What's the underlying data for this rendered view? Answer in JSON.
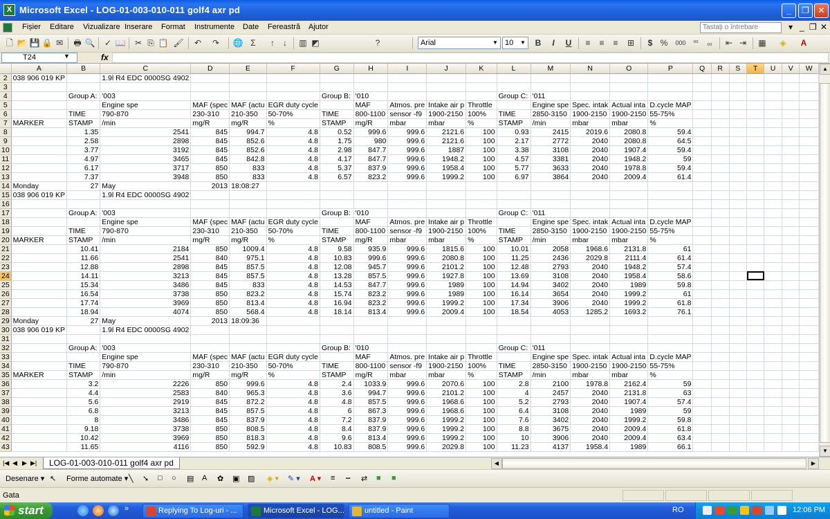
{
  "window": {
    "title": "Microsoft Excel - LOG-01-003-010-011 golf4 axr pd",
    "app_icon": "X"
  },
  "menu": {
    "items": [
      "Fișier",
      "Editare",
      "Vizualizare",
      "Inserare",
      "Format",
      "Instrumente",
      "Date",
      "Fereastră",
      "Ajutor"
    ],
    "help_placeholder": "Tastați o întrebare"
  },
  "toolbar": {
    "font_name": "Arial",
    "font_size": "10",
    "bold": "B",
    "italic": "I",
    "underline": "U",
    "currency": "$",
    "percent": "%",
    "thousands": "000",
    "inc_decimal": "⁰⁰",
    "dec_decimal": "₀₀"
  },
  "formula_bar": {
    "name_box": "T24",
    "fx_label": "fx",
    "formula": ""
  },
  "sheet": {
    "columns": [
      "A",
      "B",
      "C",
      "D",
      "E",
      "F",
      "G",
      "H",
      "I",
      "J",
      "K",
      "L",
      "M",
      "N",
      "O",
      "P",
      "Q",
      "R",
      "S",
      "T",
      "U",
      "V",
      "W"
    ],
    "selected_column": "T",
    "selected_row": "24",
    "rows": [
      {
        "n": "2",
        "c": {
          "A": "038 906 019 KP",
          "C": "1.9l R4 EDC 0000SG  4902"
        }
      },
      {
        "n": "3",
        "c": {}
      },
      {
        "n": "4",
        "c": {
          "B": "Group A:",
          "C": "'003",
          "G": "Group B:",
          "H": "'010",
          "L": "Group C:",
          "M": "'011"
        }
      },
      {
        "n": "5",
        "c": {
          "C": "Engine spe",
          "D": "MAF (spec",
          "E": "MAF (actu",
          "F": "EGR duty cycle",
          "H": "MAF",
          "I": "Atmos. pre",
          "J": "Intake air p",
          "K": "Throttle",
          "M": "Engine spe",
          "N": "Spec. intak",
          "O": "Actual inta",
          "P": "D.cycle MAP"
        }
      },
      {
        "n": "6",
        "c": {
          "B": "TIME",
          "C": "790-870",
          "D": "230-310",
          "E": "210-350",
          "F": "50-70%",
          "G": "TIME",
          "H": "800-1100",
          "I": "sensor -f9",
          "J": "1900-2150",
          "K": "100%",
          "L": "TIME",
          "M": "2850-3150",
          "N": "1900-2150",
          "O": "1900-2150",
          "P": "55-75%"
        }
      },
      {
        "n": "7",
        "c": {
          "A": "MARKER",
          "B": "STAMP",
          "C": "/min",
          "D": "mg/R",
          "E": "mg/R",
          "F": "%",
          "G": "STAMP",
          "H": "mg/R",
          "I": "mbar",
          "J": "mbar",
          "K": "%",
          "L": "STAMP",
          "M": "/min",
          "N": "mbar",
          "O": "mbar",
          "P": "%"
        }
      },
      {
        "n": "8",
        "c": {
          "B": "1.35",
          "C": "2541",
          "D": "845",
          "E": "994.7",
          "F": "4.8",
          "G": "0.52",
          "H": "999.6",
          "I": "999.6",
          "J": "2121.6",
          "K": "100",
          "L": "0.93",
          "M": "2415",
          "N": "2019.6",
          "O": "2080.8",
          "P": "59.4"
        }
      },
      {
        "n": "9",
        "c": {
          "B": "2.58",
          "C": "2898",
          "D": "845",
          "E": "852.6",
          "F": "4.8",
          "G": "1.75",
          "H": "980",
          "I": "999.6",
          "J": "2121.6",
          "K": "100",
          "L": "2.17",
          "M": "2772",
          "N": "2040",
          "O": "2080.8",
          "P": "64.5"
        }
      },
      {
        "n": "10",
        "c": {
          "B": "3.77",
          "C": "3192",
          "D": "845",
          "E": "852.6",
          "F": "4.8",
          "G": "2.98",
          "H": "847.7",
          "I": "999.6",
          "J": "1887",
          "K": "100",
          "L": "3.38",
          "M": "3108",
          "N": "2040",
          "O": "1907.4",
          "P": "59.4"
        }
      },
      {
        "n": "11",
        "c": {
          "B": "4.97",
          "C": "3465",
          "D": "845",
          "E": "842.8",
          "F": "4.8",
          "G": "4.17",
          "H": "847.7",
          "I": "999.6",
          "J": "1948.2",
          "K": "100",
          "L": "4.57",
          "M": "3381",
          "N": "2040",
          "O": "1948.2",
          "P": "59"
        }
      },
      {
        "n": "12",
        "c": {
          "B": "6.17",
          "C": "3717",
          "D": "850",
          "E": "833",
          "F": "4.8",
          "G": "5.37",
          "H": "837.9",
          "I": "999.6",
          "J": "1958.4",
          "K": "100",
          "L": "5.77",
          "M": "3633",
          "N": "2040",
          "O": "1978.8",
          "P": "59.4"
        }
      },
      {
        "n": "13",
        "c": {
          "B": "7.37",
          "C": "3948",
          "D": "850",
          "E": "833",
          "F": "4.8",
          "G": "6.57",
          "H": "823.2",
          "I": "999.6",
          "J": "1999.2",
          "K": "100",
          "L": "6.97",
          "M": "3864",
          "N": "2040",
          "O": "2009.4",
          "P": "61.4"
        }
      },
      {
        "n": "14",
        "c": {
          "A": "Monday",
          "B": "27",
          "C": "May",
          "D": "2013",
          "E": "18:08:27"
        }
      },
      {
        "n": "15",
        "c": {
          "A": "038 906 019 KP",
          "C": "1.9l R4 EDC 0000SG  4902"
        }
      },
      {
        "n": "16",
        "c": {}
      },
      {
        "n": "17",
        "c": {
          "B": "Group A:",
          "C": "'003",
          "G": "Group B:",
          "H": "'010",
          "L": "Group C:",
          "M": "'011"
        }
      },
      {
        "n": "18",
        "c": {
          "C": "Engine spe",
          "D": "MAF (spec",
          "E": "MAF (actu",
          "F": "EGR duty cycle",
          "H": "MAF",
          "I": "Atmos. pre",
          "J": "Intake air p",
          "K": "Throttle",
          "M": "Engine spe",
          "N": "Spec. intak",
          "O": "Actual inta",
          "P": "D.cycle MAP"
        }
      },
      {
        "n": "19",
        "c": {
          "B": "TIME",
          "C": "790-870",
          "D": "230-310",
          "E": "210-350",
          "F": "50-70%",
          "G": "TIME",
          "H": "800-1100",
          "I": "sensor -f9",
          "J": "1900-2150",
          "K": "100%",
          "L": "TIME",
          "M": "2850-3150",
          "N": "1900-2150",
          "O": "1900-2150",
          "P": "55-75%"
        }
      },
      {
        "n": "20",
        "c": {
          "A": "MARKER",
          "B": "STAMP",
          "C": "/min",
          "D": "mg/R",
          "E": "mg/R",
          "F": "%",
          "G": "STAMP",
          "H": "mg/R",
          "I": "mbar",
          "J": "mbar",
          "K": "%",
          "L": "STAMP",
          "M": "/min",
          "N": "mbar",
          "O": "mbar",
          "P": "%"
        }
      },
      {
        "n": "21",
        "c": {
          "B": "10.41",
          "C": "2184",
          "D": "850",
          "E": "1009.4",
          "F": "4.8",
          "G": "9.58",
          "H": "935.9",
          "I": "999.6",
          "J": "1815.6",
          "K": "100",
          "L": "10.01",
          "M": "2058",
          "N": "1968.6",
          "O": "2131.8",
          "P": "61"
        }
      },
      {
        "n": "22",
        "c": {
          "B": "11.66",
          "C": "2541",
          "D": "840",
          "E": "975.1",
          "F": "4.8",
          "G": "10.83",
          "H": "999.6",
          "I": "999.6",
          "J": "2080.8",
          "K": "100",
          "L": "11.25",
          "M": "2436",
          "N": "2029.8",
          "O": "2111.4",
          "P": "61.4"
        }
      },
      {
        "n": "23",
        "c": {
          "B": "12.88",
          "C": "2898",
          "D": "845",
          "E": "857.5",
          "F": "4.8",
          "G": "12.08",
          "H": "945.7",
          "I": "999.6",
          "J": "2101.2",
          "K": "100",
          "L": "12.48",
          "M": "2793",
          "N": "2040",
          "O": "1948.2",
          "P": "57.4"
        }
      },
      {
        "n": "24",
        "c": {
          "B": "14.11",
          "C": "3213",
          "D": "845",
          "E": "857.5",
          "F": "4.8",
          "G": "13.28",
          "H": "857.5",
          "I": "999.6",
          "J": "1927.8",
          "K": "100",
          "L": "13.69",
          "M": "3108",
          "N": "2040",
          "O": "1958.4",
          "P": "58.6"
        }
      },
      {
        "n": "25",
        "c": {
          "B": "15.34",
          "C": "3486",
          "D": "845",
          "E": "833",
          "F": "4.8",
          "G": "14.53",
          "H": "847.7",
          "I": "999.6",
          "J": "1989",
          "K": "100",
          "L": "14.94",
          "M": "3402",
          "N": "2040",
          "O": "1989",
          "P": "59.8"
        }
      },
      {
        "n": "26",
        "c": {
          "B": "16.54",
          "C": "3738",
          "D": "850",
          "E": "823.2",
          "F": "4.8",
          "G": "15.74",
          "H": "823.2",
          "I": "999.6",
          "J": "1989",
          "K": "100",
          "L": "16.14",
          "M": "3654",
          "N": "2040",
          "O": "1999.2",
          "P": "61"
        }
      },
      {
        "n": "27",
        "c": {
          "B": "17.74",
          "C": "3969",
          "D": "850",
          "E": "813.4",
          "F": "4.8",
          "G": "16.94",
          "H": "823.2",
          "I": "999.6",
          "J": "1999.2",
          "K": "100",
          "L": "17.34",
          "M": "3906",
          "N": "2040",
          "O": "1999.2",
          "P": "61.8"
        }
      },
      {
        "n": "28",
        "c": {
          "B": "18.94",
          "C": "4074",
          "D": "850",
          "E": "568.4",
          "F": "4.8",
          "G": "18.14",
          "H": "813.4",
          "I": "999.6",
          "J": "2009.4",
          "K": "100",
          "L": "18.54",
          "M": "4053",
          "N": "1285.2",
          "O": "1693.2",
          "P": "76.1"
        }
      },
      {
        "n": "29",
        "c": {
          "A": "Monday",
          "B": "27",
          "C": "May",
          "D": "2013",
          "E": "18:09:36"
        }
      },
      {
        "n": "30",
        "c": {
          "A": "038 906 019 KP",
          "C": "1.9l R4 EDC 0000SG  4902"
        }
      },
      {
        "n": "31",
        "c": {}
      },
      {
        "n": "32",
        "c": {
          "B": "Group A:",
          "C": "'003",
          "G": "Group B:",
          "H": "'010",
          "L": "Group C:",
          "M": "'011"
        }
      },
      {
        "n": "33",
        "c": {
          "C": "Engine spe",
          "D": "MAF (spec",
          "E": "MAF (actu",
          "F": "EGR duty cycle",
          "H": "MAF",
          "I": "Atmos. pre",
          "J": "Intake air p",
          "K": "Throttle",
          "M": "Engine spe",
          "N": "Spec. intak",
          "O": "Actual inta",
          "P": "D.cycle MAP"
        }
      },
      {
        "n": "34",
        "c": {
          "B": "TIME",
          "C": "790-870",
          "D": "230-310",
          "E": "210-350",
          "F": "50-70%",
          "G": "TIME",
          "H": "800-1100",
          "I": "sensor -f9",
          "J": "1900-2150",
          "K": "100%",
          "L": "TIME",
          "M": "2850-3150",
          "N": "1900-2150",
          "O": "1900-2150",
          "P": "55-75%"
        }
      },
      {
        "n": "35",
        "c": {
          "A": "MARKER",
          "B": "STAMP",
          "C": "/min",
          "D": "mg/R",
          "E": "mg/R",
          "F": "%",
          "G": "STAMP",
          "H": "mg/R",
          "I": "mbar",
          "J": "mbar",
          "K": "%",
          "L": "STAMP",
          "M": "/min",
          "N": "mbar",
          "O": "mbar",
          "P": "%"
        }
      },
      {
        "n": "36",
        "c": {
          "B": "3.2",
          "C": "2226",
          "D": "850",
          "E": "999.6",
          "F": "4.8",
          "G": "2.4",
          "H": "1033.9",
          "I": "999.6",
          "J": "2070.6",
          "K": "100",
          "L": "2.8",
          "M": "2100",
          "N": "1978.8",
          "O": "2162.4",
          "P": "59"
        }
      },
      {
        "n": "37",
        "c": {
          "B": "4.4",
          "C": "2583",
          "D": "840",
          "E": "965.3",
          "F": "4.8",
          "G": "3.6",
          "H": "994.7",
          "I": "999.6",
          "J": "2101.2",
          "K": "100",
          "L": "4",
          "M": "2457",
          "N": "2040",
          "O": "2131.8",
          "P": "63"
        }
      },
      {
        "n": "38",
        "c": {
          "B": "5.6",
          "C": "2919",
          "D": "845",
          "E": "872.2",
          "F": "4.8",
          "G": "4.8",
          "H": "857.5",
          "I": "999.6",
          "J": "1968.6",
          "K": "100",
          "L": "5.2",
          "M": "2793",
          "N": "2040",
          "O": "1907.4",
          "P": "57.4"
        }
      },
      {
        "n": "39",
        "c": {
          "B": "6.8",
          "C": "3213",
          "D": "845",
          "E": "857.5",
          "F": "4.8",
          "G": "6",
          "H": "867.3",
          "I": "999.6",
          "J": "1968.6",
          "K": "100",
          "L": "6.4",
          "M": "3108",
          "N": "2040",
          "O": "1989",
          "P": "59"
        }
      },
      {
        "n": "40",
        "c": {
          "B": "8",
          "C": "3486",
          "D": "845",
          "E": "837.9",
          "F": "4.8",
          "G": "7.2",
          "H": "837.9",
          "I": "999.6",
          "J": "1999.2",
          "K": "100",
          "L": "7.6",
          "M": "3402",
          "N": "2040",
          "O": "1999.2",
          "P": "59.8"
        }
      },
      {
        "n": "41",
        "c": {
          "B": "9.18",
          "C": "3738",
          "D": "850",
          "E": "808.5",
          "F": "4.8",
          "G": "8.4",
          "H": "837.9",
          "I": "999.6",
          "J": "1999.2",
          "K": "100",
          "L": "8.8",
          "M": "3675",
          "N": "2040",
          "O": "2009.4",
          "P": "61.8"
        }
      },
      {
        "n": "42",
        "c": {
          "B": "10.42",
          "C": "3969",
          "D": "850",
          "E": "818.3",
          "F": "4.8",
          "G": "9.6",
          "H": "813.4",
          "I": "999.6",
          "J": "1999.2",
          "K": "100",
          "L": "10",
          "M": "3906",
          "N": "2040",
          "O": "2009.4",
          "P": "63.4"
        }
      },
      {
        "n": "43",
        "c": {
          "B": "11.65",
          "C": "4116",
          "D": "850",
          "E": "592.9",
          "F": "4.8",
          "G": "10.83",
          "H": "808.5",
          "I": "999.6",
          "J": "2029.8",
          "K": "100",
          "L": "11.23",
          "M": "4137",
          "N": "1958.4",
          "O": "1989",
          "P": "66.1"
        }
      }
    ]
  },
  "sheet_tab": "LOG-01-003-010-011 golf4 axr pd",
  "drawing_toolbar": {
    "draw_label": "Desenare",
    "autoshapes_label": "Forme automate"
  },
  "status": {
    "text": "Gata"
  },
  "taskbar": {
    "start_label": "start",
    "items": [
      {
        "label": "Replying To Log-uri - ...",
        "active": false,
        "color": "#d9462d"
      },
      {
        "label": "Microsoft Excel - LOG...",
        "active": true,
        "color": "#1d7a3a"
      },
      {
        "label": "untitled - Paint",
        "active": false,
        "color": "#e5b53a"
      }
    ],
    "language": "RO",
    "clock": "12:06 PM"
  }
}
